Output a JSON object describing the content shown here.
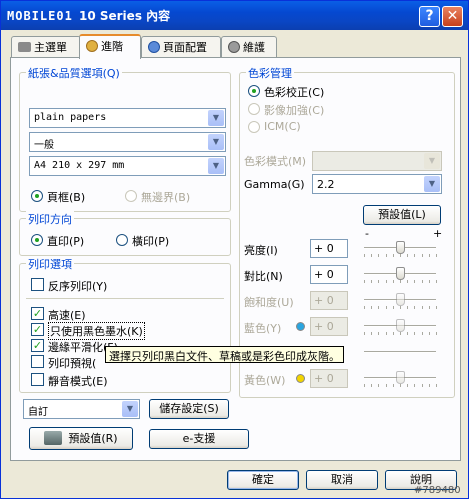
{
  "window": {
    "title_logo": "MOBILE01",
    "title": "10 Series 內容",
    "help_glyph": "?",
    "close_glyph": "✕"
  },
  "tabs": [
    {
      "label": "主選單"
    },
    {
      "label": "進階"
    },
    {
      "label": "頁面配置"
    },
    {
      "label": "維護"
    }
  ],
  "paper_quality": {
    "title": "紙張&品質選項(Q)",
    "media_type": "plain papers",
    "quality": "一般",
    "paper_size": "A4 210 x 297 mm",
    "border_label": "頁框(B)",
    "borderless_label": "無邊界(B)"
  },
  "orientation": {
    "title": "列印方向",
    "portrait_label": "直印(P)",
    "landscape_label": "橫印(P)"
  },
  "print_options": {
    "title": "列印選項",
    "reverse_order": "反序列印(Y)",
    "high_speed": "高速(E)",
    "black_ink_only": "只使用黑色墨水(K)",
    "edge_smoothing": "邊緣平滑化(F)",
    "print_preview": "列印預視(",
    "quiet_mode": "靜音模式(E)"
  },
  "tooltip": "選擇只列印黑白文件、草稿或是彩色印成灰階。",
  "bottom_left": {
    "preset": "自訂",
    "save_settings": "儲存設定(S)",
    "defaults": "預設值(R)",
    "esupport": "e-支援"
  },
  "color_management": {
    "title": "色彩管理",
    "color_controls": "色彩校正(C)",
    "photo_enhance": "影像加強(C)",
    "icm": "ICM(C)",
    "color_mode_label": "色彩模式(M)",
    "gamma_label": "Gamma(G)",
    "gamma_value": "2.2",
    "defaults_button": "預設值(L)",
    "minus": "-",
    "plus": "+",
    "sliders": [
      {
        "label": "亮度(I)",
        "value": "+ 0",
        "level": 0.5,
        "enabled": true,
        "color": ""
      },
      {
        "label": "對比(N)",
        "value": "+ 0",
        "level": 0.5,
        "enabled": true,
        "color": ""
      },
      {
        "label": "飽和度(U)",
        "value": "+ 0",
        "level": 0.5,
        "enabled": false,
        "color": ""
      },
      {
        "label": "藍色(Y)",
        "value": "+ 0",
        "level": 0.5,
        "enabled": false,
        "color": "#2aa5e0"
      },
      {
        "label": "",
        "value": "",
        "level": 0.5,
        "enabled": false,
        "color": ""
      },
      {
        "label": "黃色(W)",
        "value": "+ 0",
        "level": 0.5,
        "enabled": false,
        "color": "#f2d400"
      }
    ]
  },
  "footer": {
    "ok": "確定",
    "cancel": "取消",
    "help": "說明",
    "watermark": "#789480"
  }
}
